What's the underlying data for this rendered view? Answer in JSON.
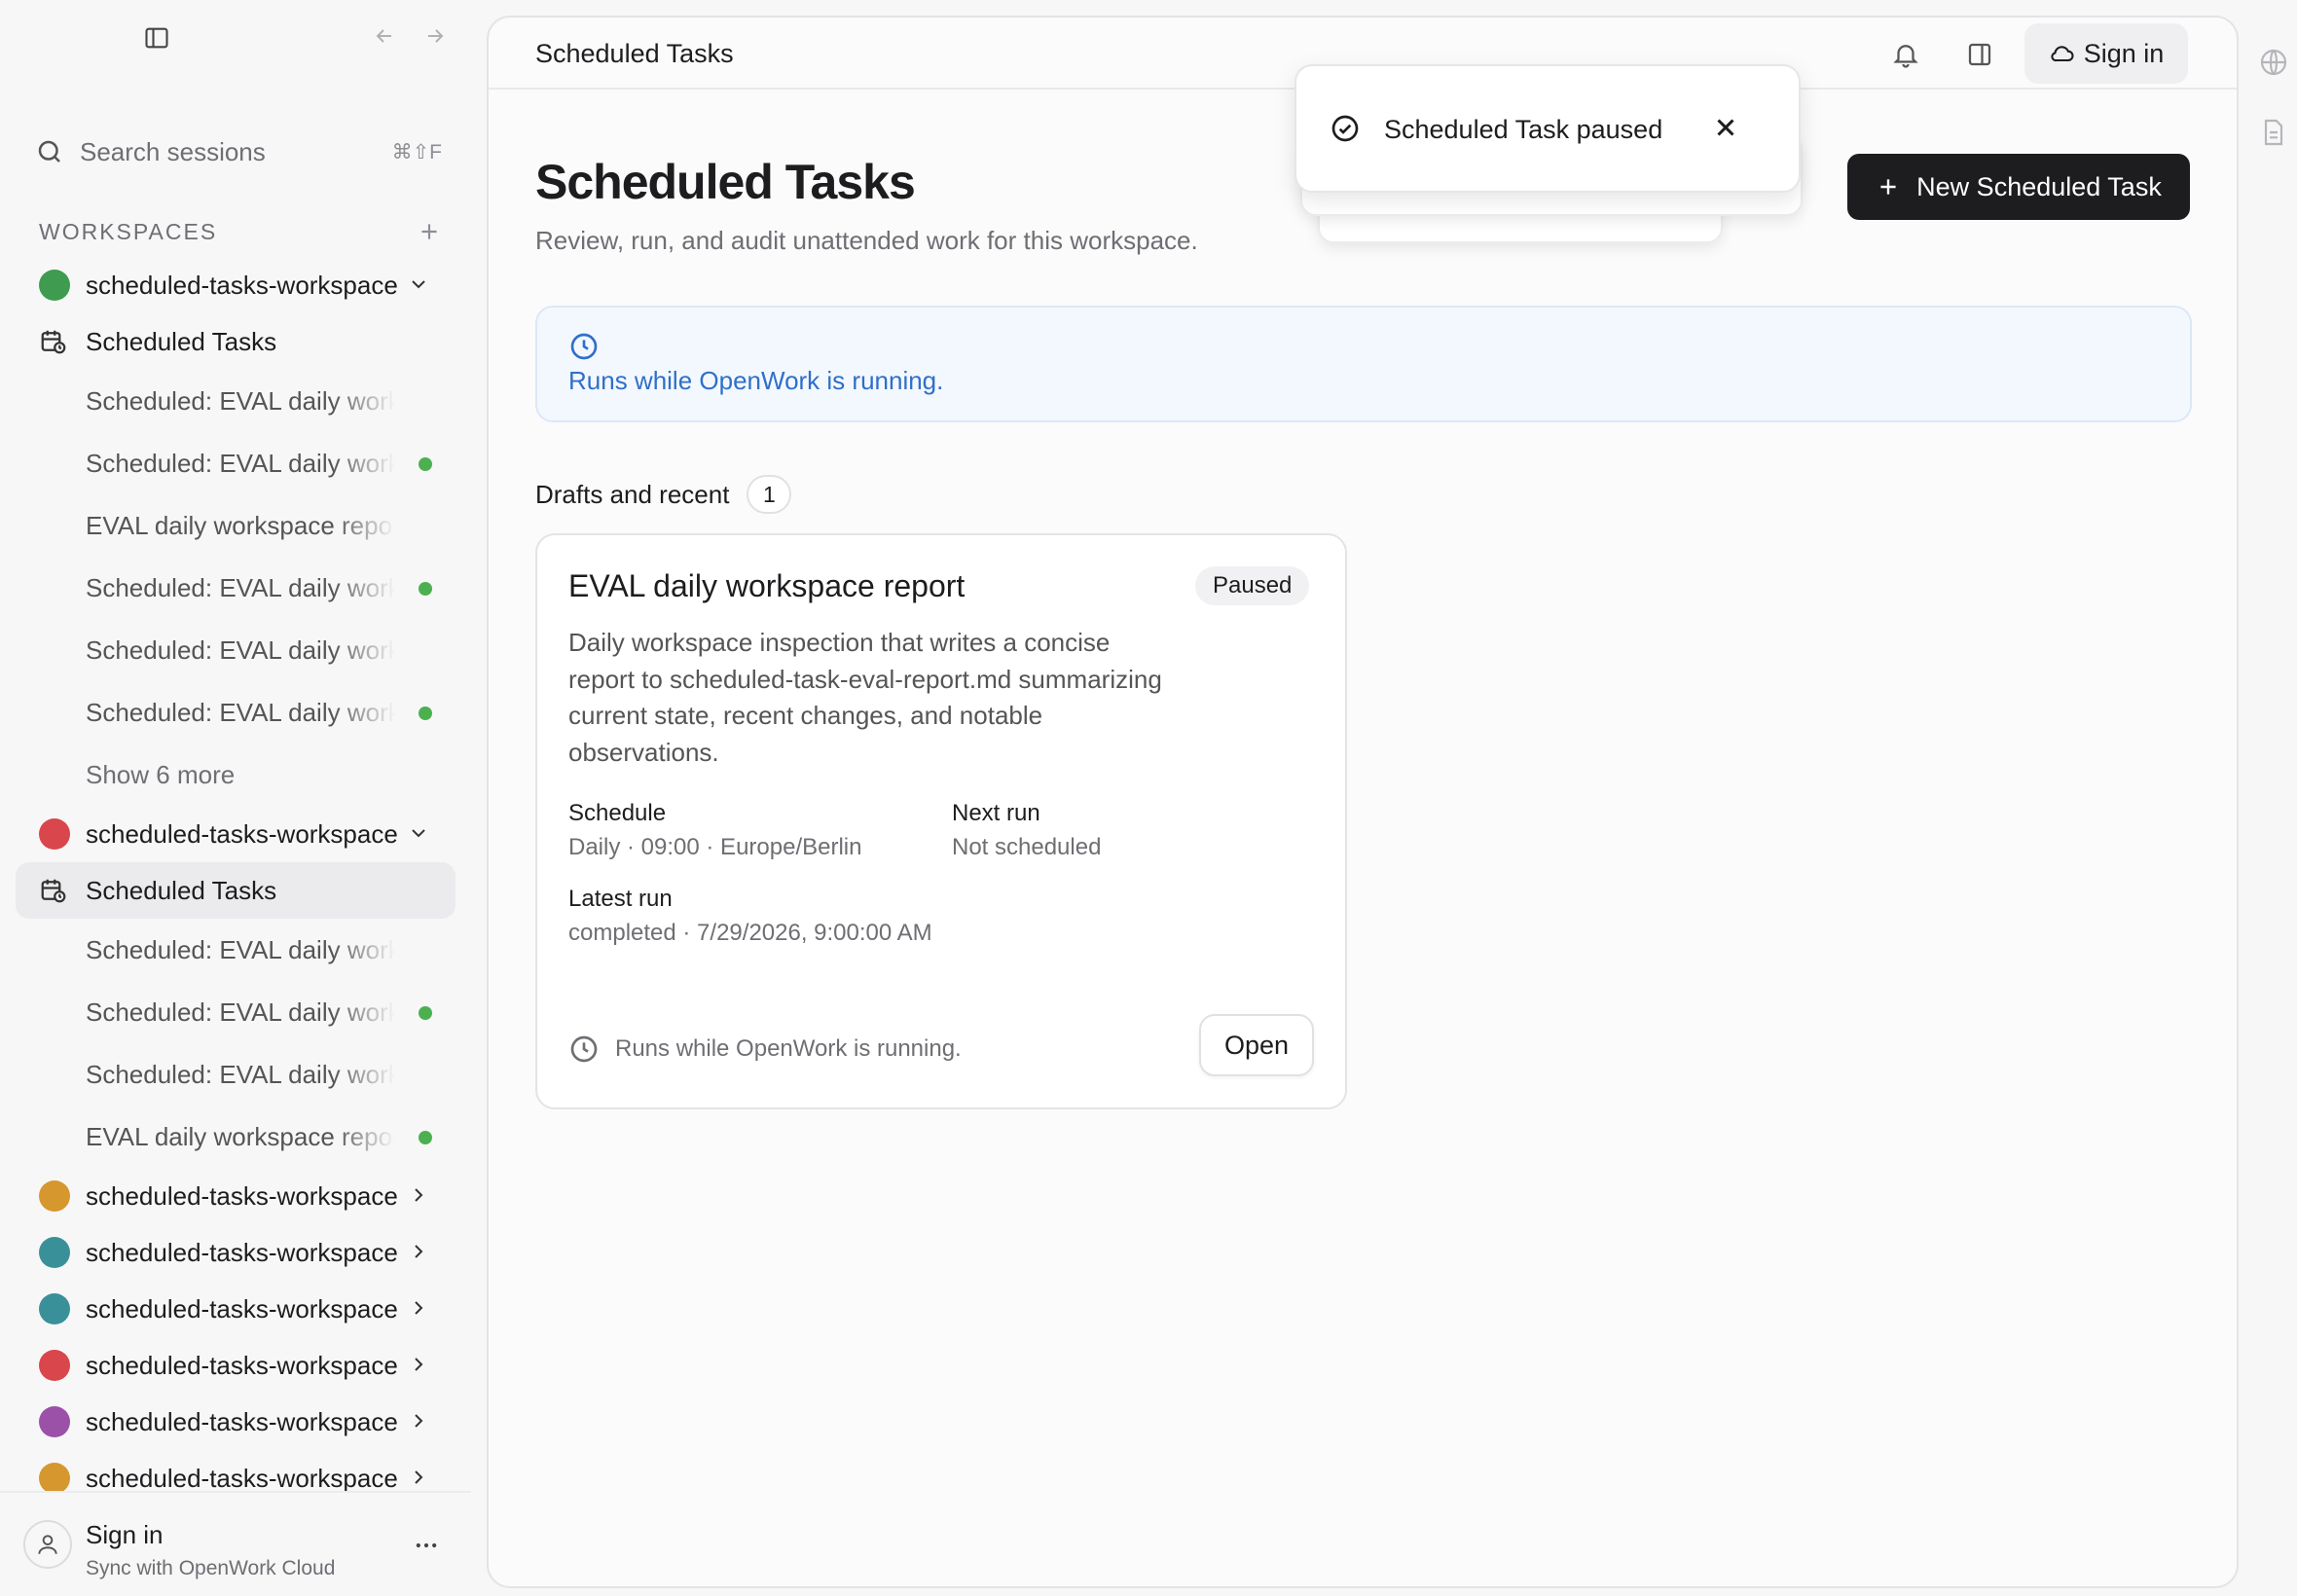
{
  "sidebar": {
    "search_placeholder": "Search sessions",
    "search_shortcut": "⌘⇧F",
    "workspaces_label": "WORKSPACES",
    "workspaces": [
      {
        "name": "scheduled-tasks-workspace",
        "color": "#3e9b4f",
        "expanded": true,
        "scheduled_label": "Scheduled Tasks",
        "sessions": [
          {
            "label": "Scheduled: EVAL daily workspace report",
            "active": false
          },
          {
            "label": "Scheduled: EVAL daily workspace report",
            "active": true
          },
          {
            "label": "EVAL daily workspace report",
            "active": false
          },
          {
            "label": "Scheduled: EVAL daily workspace report",
            "active": true
          },
          {
            "label": "Scheduled: EVAL daily workspace report",
            "active": false
          },
          {
            "label": "Scheduled: EVAL daily workspace report",
            "active": true
          }
        ],
        "show_more": "Show 6 more"
      },
      {
        "name": "scheduled-tasks-workspace",
        "color": "#d9464b",
        "expanded": true,
        "scheduled_label": "Scheduled Tasks",
        "sessions": [
          {
            "label": "Scheduled: EVAL daily workspace report",
            "active": false
          },
          {
            "label": "Scheduled: EVAL daily workspace report",
            "active": true
          },
          {
            "label": "Scheduled: EVAL daily workspace report",
            "active": false
          },
          {
            "label": "EVAL daily workspace report",
            "active": true
          }
        ]
      },
      {
        "name": "scheduled-tasks-workspace",
        "color": "#d6972e",
        "expanded": false
      },
      {
        "name": "scheduled-tasks-workspace",
        "color": "#3a9099",
        "expanded": false
      },
      {
        "name": "scheduled-tasks-workspace",
        "color": "#3a9099",
        "expanded": false
      },
      {
        "name": "scheduled-tasks-workspace",
        "color": "#d9464b",
        "expanded": false
      },
      {
        "name": "scheduled-tasks-workspace",
        "color": "#9b51a7",
        "expanded": false
      },
      {
        "name": "scheduled-tasks-workspace",
        "color": "#d6972e",
        "expanded": false
      }
    ],
    "footer": {
      "title": "Sign in",
      "subtitle": "Sync with OpenWork Cloud"
    }
  },
  "topbar": {
    "title": "Scheduled Tasks",
    "signin_label": "Sign in"
  },
  "toast": {
    "message": "Scheduled Task paused"
  },
  "page": {
    "title": "Scheduled Tasks",
    "subtitle": "Review, run, and audit unattended work for this workspace.",
    "new_button": "New Scheduled Task",
    "info_text": "Runs while OpenWork is running.",
    "section_title": "Drafts and recent",
    "section_count": "1"
  },
  "card": {
    "title": "EVAL daily workspace report",
    "status": "Paused",
    "description": "Daily workspace inspection that writes a concise report to scheduled-task-eval-report.md summarizing current state, recent changes, and notable observations.",
    "schedule_label": "Schedule",
    "schedule_value": "Daily · 09:00 · Europe/Berlin",
    "next_run_label": "Next run",
    "next_run_value": "Not scheduled",
    "latest_run_label": "Latest run",
    "latest_run_value": "completed · 7/29/2026, 9:00:00 AM",
    "footer_text": "Runs while OpenWork is running.",
    "open_button": "Open"
  },
  "colors": {
    "accent_blue": "#2f6fc9",
    "primary_button": "#1d1d1f",
    "active_dot": "#4cb050"
  }
}
